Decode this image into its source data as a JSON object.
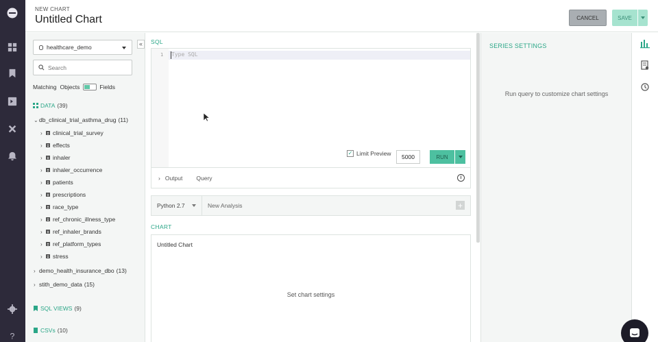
{
  "header": {
    "subtitle": "NEW CHART",
    "title": "Untitled Chart",
    "cancel_label": "CANCEL",
    "save_label": "SAVE"
  },
  "rail": {
    "icons": [
      "logo-icon",
      "dashboard-icon",
      "bookmark-icon",
      "editor-icon",
      "tools-icon",
      "bell-icon",
      "settings-icon",
      "help-icon"
    ]
  },
  "schema": {
    "database": "healthcare_demo",
    "collapse_label": "«",
    "search_placeholder": "Search",
    "matching_label": "Matching",
    "objects_label": "Objects",
    "fields_label": "Fields",
    "data_section": {
      "label": "DATA",
      "count": "(39)"
    },
    "databases": [
      {
        "name": "db_clinical_trial_asthma_drug",
        "count": "(11)",
        "expanded": true,
        "tables": [
          "clinical_trial_survey",
          "effects",
          "inhaler",
          "inhaler_occurrence",
          "patients",
          "prescriptions",
          "race_type",
          "ref_chronic_illness_type",
          "ref_inhaler_brands",
          "ref_platform_types",
          "stress"
        ]
      },
      {
        "name": "demo_health_insurance_dbo",
        "count": "(13)",
        "expanded": false
      },
      {
        "name": "stith_demo_data",
        "count": "(15)",
        "expanded": false
      }
    ],
    "sql_views": {
      "label": "SQL VIEWS",
      "count": "(9)"
    },
    "csvs": {
      "label": "CSVs",
      "count": "(10)"
    }
  },
  "sql": {
    "section_title": "SQL",
    "line_number": "1",
    "placeholder": "Type SQL",
    "limit_preview_label": "Limit Preview",
    "limit_preview_checked": true,
    "limit_value": "5000",
    "run_label": "RUN",
    "tabs": [
      "Output",
      "Query"
    ],
    "output_chevron": "›",
    "info_icon": "i"
  },
  "analysis": {
    "language": "Python 2.7",
    "new_analysis_label": "New Analysis",
    "add_icon": "+"
  },
  "chart": {
    "section_title": "CHART",
    "chart_title": "Untitled Chart",
    "empty_message": "Set chart settings"
  },
  "series_settings": {
    "title": "SERIES SETTINGS",
    "empty_message": "Run query to customize chart settings"
  },
  "colors": {
    "accent": "#2aa687",
    "run_button": "#4dc0a0",
    "rail": "#2d2a3a",
    "save_button": "#a6e3cf",
    "cancel_button": "#a9aeb2"
  }
}
